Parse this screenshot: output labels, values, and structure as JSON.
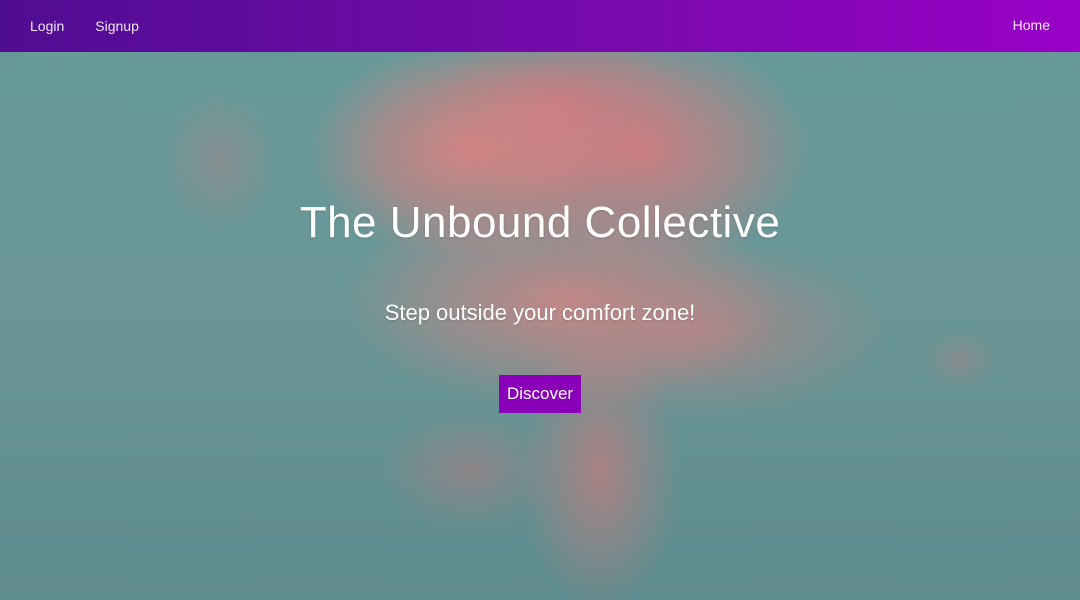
{
  "nav": {
    "login_label": "Login",
    "signup_label": "Signup",
    "home_label": "Home"
  },
  "hero": {
    "title": "The Unbound Collective",
    "subtitle": "Step outside your comfort zone!",
    "cta_label": "Discover"
  },
  "colors": {
    "nav_gradient_start": "#4f0d92",
    "nav_gradient_end": "#9a00c8",
    "cta_background": "#8a00b8",
    "sky": "#6a9797",
    "cloud": "#d68282"
  }
}
